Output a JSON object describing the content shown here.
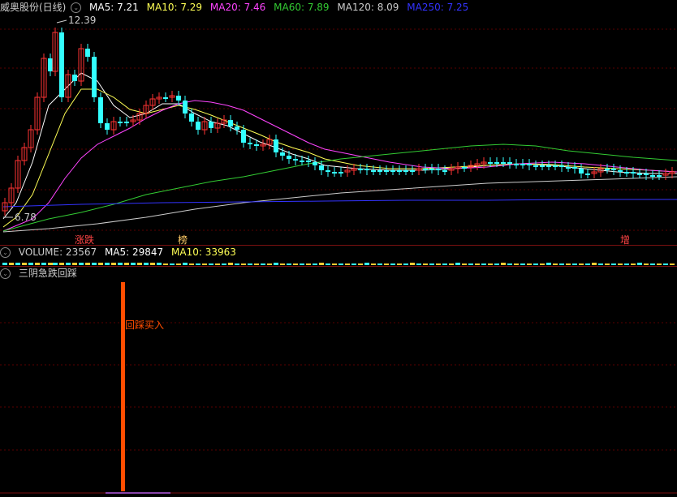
{
  "main_header": {
    "title": "威奥股份(日线)",
    "ma5_label": "MA5: 7.21",
    "ma10_label": "MA10: 7.29",
    "ma20_label": "MA20: 7.46",
    "ma60_label": "MA60: 7.89",
    "ma120_label": "MA120: 8.09",
    "ma250_label": "MA250: 7.25"
  },
  "price_labels": {
    "high": "12.39",
    "low": "6.78"
  },
  "markers": {
    "m1": "涨跌",
    "m2": "榜",
    "m3": "增"
  },
  "volume_header": {
    "volume_label": "VOLUME: 23567",
    "ma5_label": "MA5: 29847",
    "ma10_label": "MA10: 33963"
  },
  "indicator_header": {
    "title": "三阴急跌回踩"
  },
  "signal": {
    "label": "回踩买入"
  },
  "colors": {
    "up": "#ff3333",
    "down": "#33ffff",
    "ma5": "#ffffff",
    "ma10": "#ffff55",
    "ma20": "#ff44ff",
    "ma60": "#33cc33",
    "ma120": "#cccccc",
    "ma250": "#3333ff",
    "signal": "#ff4d00"
  }
}
